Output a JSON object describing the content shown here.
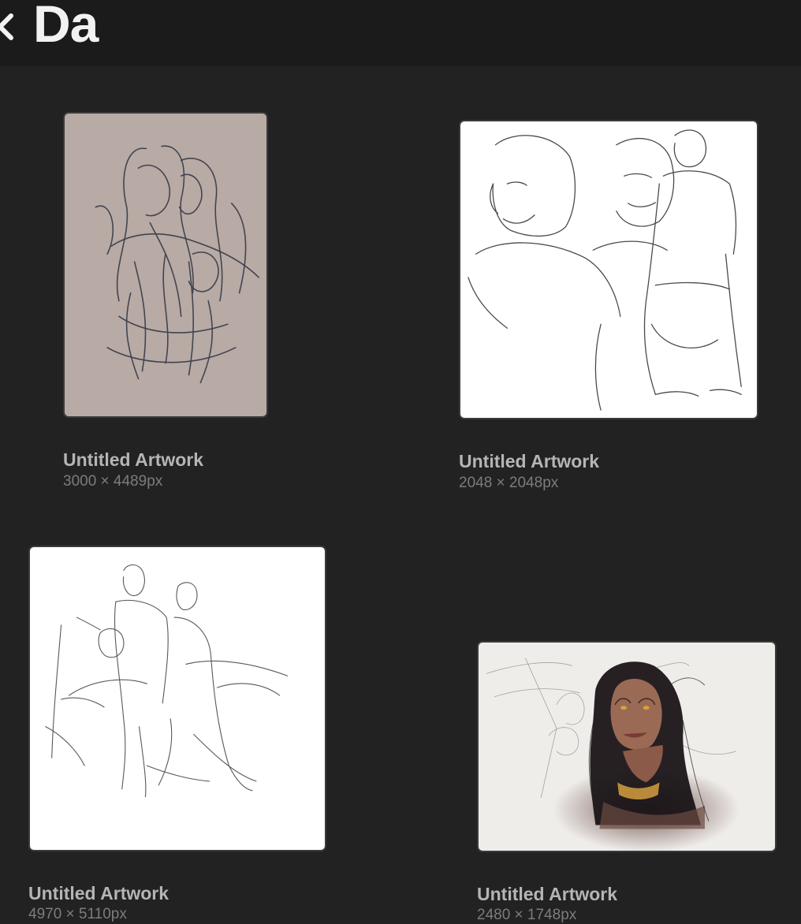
{
  "header": {
    "title": "Da",
    "back_icon": "chevron-left-icon"
  },
  "colors": {
    "background": "#222222",
    "header_bg": "#1b1b1b",
    "title_text": "#f2f2f2",
    "caption_text": "#b5b5b5",
    "size_text": "#7c7c7c"
  },
  "artworks": [
    {
      "title": "Untitled Artwork",
      "size": "3000 × 4489px"
    },
    {
      "title": "Untitled Artwork",
      "size": "2048 × 2048px"
    },
    {
      "title": "Untitled Artwork",
      "size": "4970 × 5110px"
    },
    {
      "title": "Untitled Artwork",
      "size": "2480 × 1748px"
    }
  ]
}
